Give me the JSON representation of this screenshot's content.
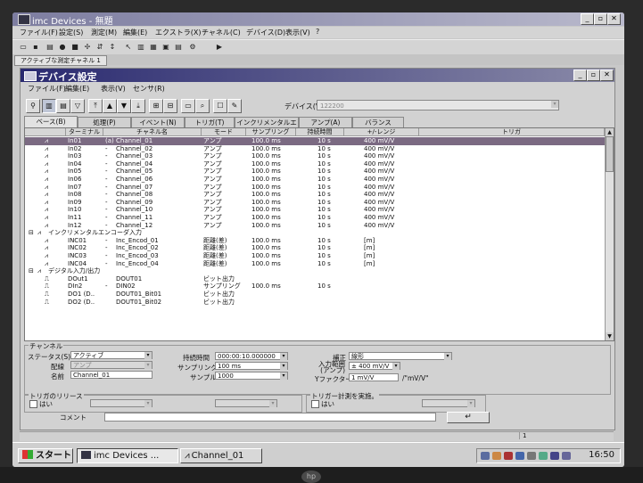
{
  "app": {
    "title": "imc Devices - 無題",
    "menu": [
      "ファイル(F)",
      "設定(S)",
      "測定(M)",
      "編集(E)",
      "エクストラ(X)",
      "チャネル(C)",
      "デバイス(D)",
      "表示(V)",
      "?"
    ],
    "open_tab": "アクティブな測定チャネル 1"
  },
  "child": {
    "title": "デバイス設定",
    "menu": [
      "ファイル(F)",
      "編集(E)",
      "表示(V)",
      "センサ(R)"
    ],
    "device_label": "デバイス(V)",
    "device_value": "122200"
  },
  "tabs": [
    "ベース(B)",
    "処理(P)",
    "イベント(N)",
    "トリガ(T)",
    "インクリメンタルエンコー",
    "アンプ(A)",
    "バランス"
  ],
  "columns": [
    "ターミナル",
    "チャネル名",
    "モード",
    "サンプリング",
    "持続時間",
    "+/-レンジ",
    "トリガ"
  ],
  "rows": [
    {
      "terminal": "In01",
      "conn": "(a)",
      "name": "Channel_01",
      "mode": "アンプ",
      "sampling": "100.0  ms",
      "duration": "10 s",
      "range": "400  mV/V",
      "selected": true
    },
    {
      "terminal": "In02",
      "conn": "-",
      "name": "Channel_02",
      "mode": "アンプ",
      "sampling": "100.0  ms",
      "duration": "10 s",
      "range": "400  mV/V"
    },
    {
      "terminal": "In03",
      "conn": "-",
      "name": "Channel_03",
      "mode": "アンプ",
      "sampling": "100.0  ms",
      "duration": "10 s",
      "range": "400  mV/V"
    },
    {
      "terminal": "In04",
      "conn": "-",
      "name": "Channel_04",
      "mode": "アンプ",
      "sampling": "100.0  ms",
      "duration": "10 s",
      "range": "400  mV/V"
    },
    {
      "terminal": "In05",
      "conn": "-",
      "name": "Channel_05",
      "mode": "アンプ",
      "sampling": "100.0  ms",
      "duration": "10 s",
      "range": "400  mV/V"
    },
    {
      "terminal": "In06",
      "conn": "-",
      "name": "Channel_06",
      "mode": "アンプ",
      "sampling": "100.0  ms",
      "duration": "10 s",
      "range": "400  mV/V"
    },
    {
      "terminal": "In07",
      "conn": "-",
      "name": "Channel_07",
      "mode": "アンプ",
      "sampling": "100.0  ms",
      "duration": "10 s",
      "range": "400  mV/V"
    },
    {
      "terminal": "In08",
      "conn": "-",
      "name": "Channel_08",
      "mode": "アンプ",
      "sampling": "100.0  ms",
      "duration": "10 s",
      "range": "400  mV/V"
    },
    {
      "terminal": "In09",
      "conn": "-",
      "name": "Channel_09",
      "mode": "アンプ",
      "sampling": "100.0  ms",
      "duration": "10 s",
      "range": "400  mV/V"
    },
    {
      "terminal": "In10",
      "conn": "-",
      "name": "Channel_10",
      "mode": "アンプ",
      "sampling": "100.0  ms",
      "duration": "10 s",
      "range": "400  mV/V"
    },
    {
      "terminal": "In11",
      "conn": "-",
      "name": "Channel_11",
      "mode": "アンプ",
      "sampling": "100.0  ms",
      "duration": "10 s",
      "range": "400  mV/V"
    },
    {
      "terminal": "In12",
      "conn": "-",
      "name": "Channel_12",
      "mode": "アンプ",
      "sampling": "100.0  ms",
      "duration": "10 s",
      "range": "400  mV/V"
    }
  ],
  "group_inc": "インクリメンタルエンコーダ入力",
  "inc_rows": [
    {
      "terminal": "INC01",
      "conn": "-",
      "name": "Inc_Encod_01",
      "mode": "距離(差)",
      "sampling": "100.0  ms",
      "duration": "10 s",
      "range": "[m]"
    },
    {
      "terminal": "INC02",
      "conn": "-",
      "name": "Inc_Encod_02",
      "mode": "距離(差)",
      "sampling": "100.0  ms",
      "duration": "10 s",
      "range": "[m]"
    },
    {
      "terminal": "INC03",
      "conn": "-",
      "name": "Inc_Encod_03",
      "mode": "距離(差)",
      "sampling": "100.0  ms",
      "duration": "10 s",
      "range": "[m]"
    },
    {
      "terminal": "INC04",
      "conn": "-",
      "name": "Inc_Encod_04",
      "mode": "距離(差)",
      "sampling": "100.0  ms",
      "duration": "10 s",
      "range": "[m]"
    }
  ],
  "group_dig": "デジタル入力/出力",
  "dig_rows": [
    {
      "terminal": "DOut1",
      "conn": "",
      "name": "DOUT01",
      "mode": "ビット出力"
    },
    {
      "terminal": "DIn2",
      "conn": "-",
      "name": "DIN02",
      "mode": "サンプリング",
      "sampling": "100.0  ms",
      "duration": "10 s"
    },
    {
      "terminal": "DO1 (D..",
      "conn": "",
      "name": "DOUT01_Bit01",
      "mode": "ビット出力"
    },
    {
      "terminal": "DO2 (D..",
      "conn": "",
      "name": "DOUT01_Bit02",
      "mode": "ビット出力"
    }
  ],
  "panel": {
    "channel_legend": "チャンネル",
    "status_label": "ステータス(S)",
    "status_value": "アクティブ",
    "wiring_label": "配線",
    "wiring_value": "アンプ",
    "name_label": "名前",
    "name_value": "Channel_01",
    "duration_label": "持続時間",
    "duration_value": "000:00:10.000000",
    "sampling_label": "サンプリング",
    "sampling_value": "100  ms",
    "samples_label": "サンプル",
    "samples_value": "1000",
    "correction_label": "補正",
    "correction_value": "線形",
    "input_range_label": "入力範囲\n(アンプ)",
    "input_range_value": "± 400 mV/V",
    "yfactor_label": "Yファクター",
    "yfactor_value": "1  mV/V",
    "yfactor_unit": "/\"mV/V\"",
    "trigger_release_legend": "トリガのリリース",
    "trigger_release_check": "はい",
    "trigger_measure_legend": "トリガー計測を実施。",
    "trigger_measure_check": "はい",
    "comment_label": "コメント",
    "enter_symbol": "↵"
  },
  "status_right": "1",
  "taskbar": {
    "start": "スタート",
    "tasks": [
      "imc Devices ...",
      "Channel_01"
    ],
    "clock": "16:50"
  },
  "brand": "hp"
}
